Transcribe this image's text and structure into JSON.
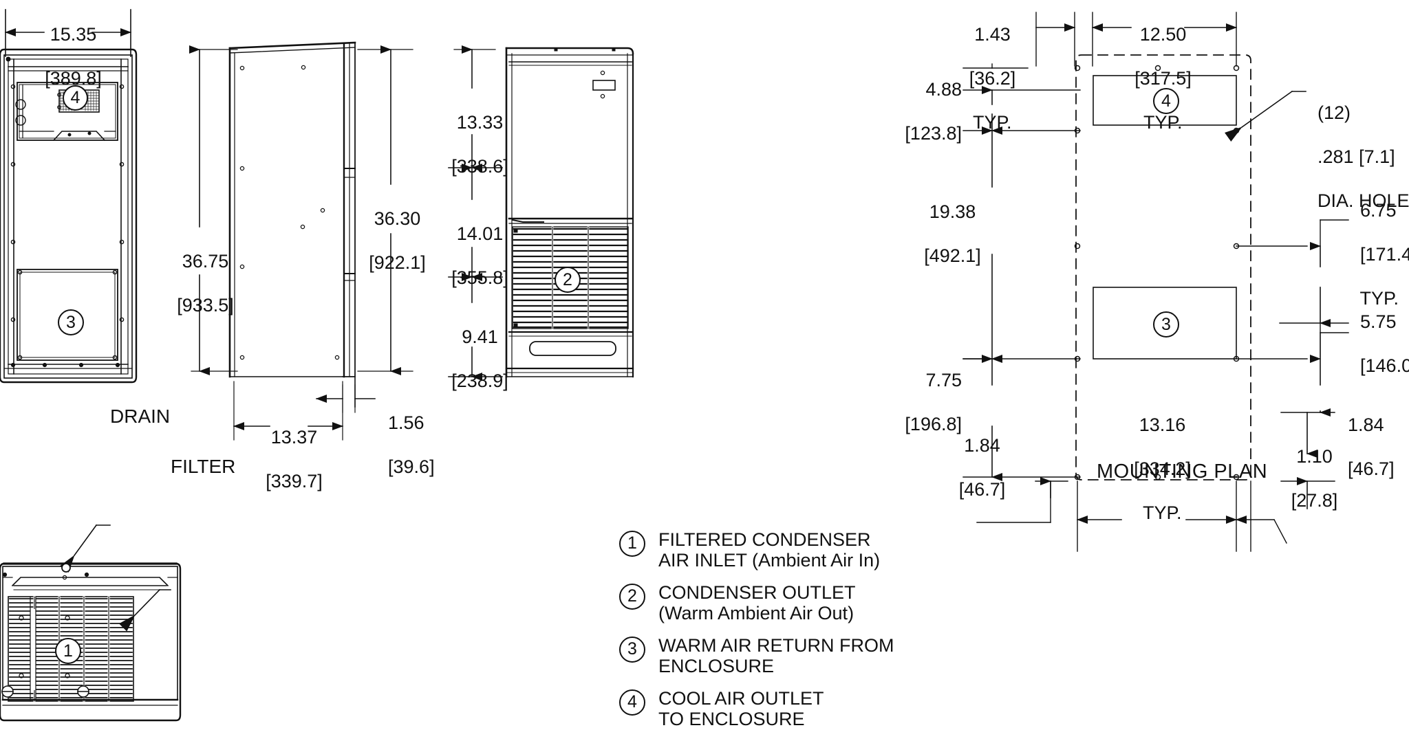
{
  "drawing": {
    "title": "MOUNTING PLAN",
    "units_note": "inches [millimeters]"
  },
  "views": {
    "front": {
      "name": "front-view",
      "bubbles": [
        "4",
        "3"
      ],
      "width_dim": {
        "in": "15.35",
        "mm": "[389.8]"
      }
    },
    "side": {
      "name": "side-view",
      "height_dim_left": {
        "in": "36.75",
        "mm": "[933.5]"
      },
      "height_dim_right": {
        "in": "36.30",
        "mm": "[922.1]"
      },
      "depth_dim": {
        "in": "13.37",
        "mm": "[339.7]"
      },
      "flange_dim": {
        "in": "1.56",
        "mm": "[39.6]"
      }
    },
    "rear": {
      "name": "rear-view",
      "bubbles": [
        "2"
      ],
      "top_dim": {
        "in": "13.33",
        "mm": "[338.6]"
      },
      "mid_dim": {
        "in": "14.01",
        "mm": "[355.8]"
      },
      "bottom_dim": {
        "in": "9.41",
        "mm": "[238.9]"
      }
    },
    "bottom": {
      "name": "bottom-view",
      "bubbles": [
        "1"
      ],
      "drain_label": "DRAIN",
      "filter_label": "FILTER"
    }
  },
  "mounting_plan": {
    "label": "MOUNTING PLAN",
    "hole_callout": {
      "qty": "(12)",
      "size": ".281 [7.1]",
      "desc": "DIA. HOLES"
    },
    "dims": {
      "top_left": {
        "in": "1.43",
        "mm": "[36.2]",
        "typ": "TYP."
      },
      "top_right": {
        "in": "12.50",
        "mm": "[317.5]",
        "typ": "TYP."
      },
      "left_upper": {
        "in": "4.88",
        "mm": "[123.8]"
      },
      "left_mid": {
        "in": "19.38",
        "mm": "[492.1]"
      },
      "left_lower": {
        "in": "7.75",
        "mm": "[196.8]"
      },
      "bottom_left_offset": {
        "in": "1.84",
        "mm": "[46.7]"
      },
      "bottom_center": {
        "in": "13.16",
        "mm": "[334.2]",
        "typ": "TYP."
      },
      "bottom_right_small": {
        "in": "1.10",
        "mm": "[27.8]"
      },
      "bottom_right_offset": {
        "in": "1.84",
        "mm": "[46.7]"
      },
      "right_upper": {
        "in": "6.75",
        "mm": "[171.4]",
        "typ": "TYP."
      },
      "right_lower": {
        "in": "5.75",
        "mm": "[146.0]"
      }
    },
    "bubbles": [
      "4",
      "3"
    ]
  },
  "legend": {
    "items": [
      {
        "num": "1",
        "text": "FILTERED CONDENSER\nAIR INLET (Ambient Air In)"
      },
      {
        "num": "2",
        "text": "CONDENSER OUTLET\n(Warm Ambient Air Out)"
      },
      {
        "num": "3",
        "text": "WARM AIR RETURN FROM\nENCLOSURE"
      },
      {
        "num": "4",
        "text": "COOL AIR OUTLET\nTO ENCLOSURE"
      }
    ]
  },
  "colors": {
    "line": "#111111",
    "background": "#ffffff",
    "light_line": "#555555"
  }
}
